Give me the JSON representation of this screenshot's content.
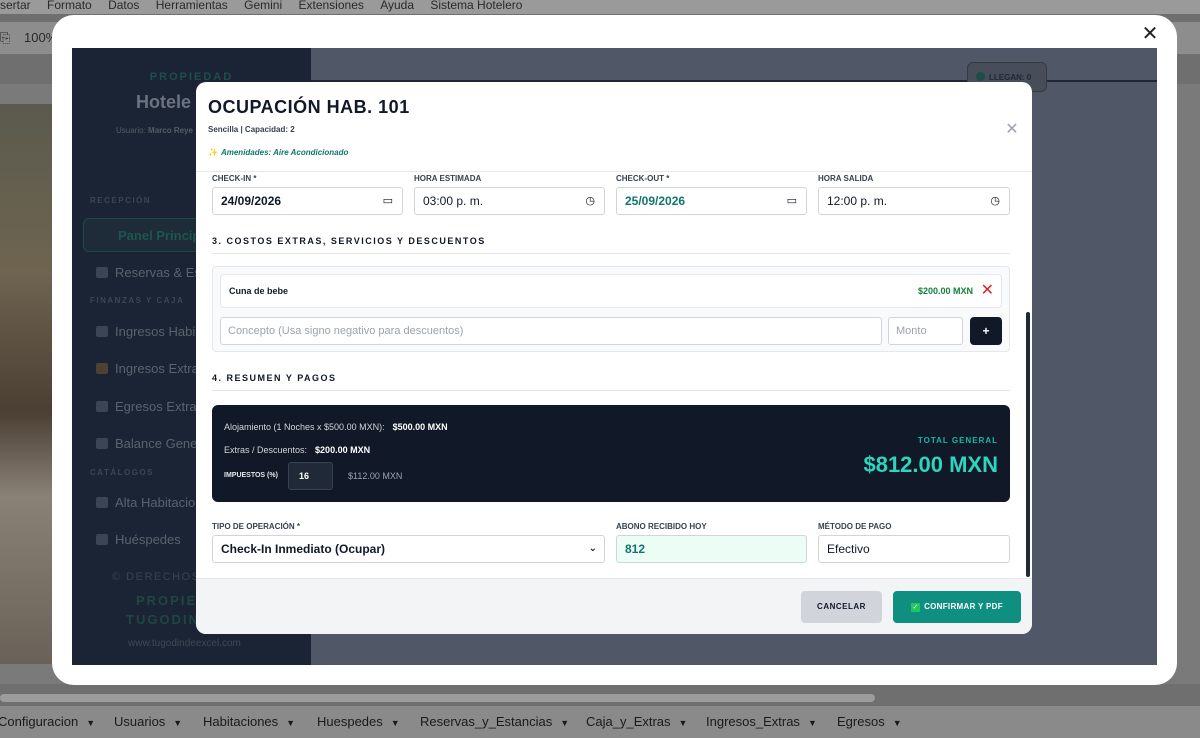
{
  "spreadsheet": {
    "menu": [
      "sertar",
      "Formato",
      "Datos",
      "Herramientas",
      "Gemini",
      "Extensiones",
      "Ayuda",
      "Sistema Hotelero"
    ],
    "zoom": "100%",
    "sheet_tabs": [
      "Configuracion",
      "Usuarios",
      "Habitaciones",
      "Huespedes",
      "Reservas_y_Estancias",
      "Caja_y_Extras",
      "Ingresos_Extras",
      "Egresos"
    ]
  },
  "sidebar": {
    "property_label": "PROPIEDAD",
    "brand": "Hotele",
    "user_label": "Usuario:",
    "user_name": "Marco Reye",
    "sections": {
      "reception": "RECEPCIÓN",
      "finance": "FINANZAS Y CAJA",
      "catalogs": "CATÁLOGOS"
    },
    "items": {
      "panel": "Panel Principa",
      "reservas": "Reservas & Es",
      "ingresos_hab": "Ingresos Habi",
      "ingresos_extra": "Ingresos Extra",
      "egresos": "Egresos Extras",
      "balance": "Balance Gene",
      "alta": "Alta Habitacio",
      "huespedes": "Huéspedes"
    },
    "footer": {
      "copyright": "© DERECHOS",
      "prop": "PROPIE",
      "tugo": "TUGODIN",
      "url": "www.tugodindeexcel.com"
    }
  },
  "header_widget": {
    "llegan_label": "LLEGAN:",
    "llegan_count": "0"
  },
  "modal": {
    "title": "OCUPACIÓN HAB. 101",
    "subtitle": "Sencilla | Capacidad: 2",
    "amenities": "Amenidades: Aire Acondicionado",
    "dates": {
      "checkin_label": "CHECK-IN *",
      "checkin_value": "24/09/2026",
      "hora_estimada_label": "HORA ESTIMADA",
      "hora_estimada_value": "03:00 p. m.",
      "checkout_label": "CHECK-OUT *",
      "checkout_value": "25/09/2026",
      "hora_salida_label": "HORA SALIDA",
      "hora_salida_value": "12:00 p. m."
    },
    "section3_title": "3. COSTOS EXTRAS, SERVICIOS Y DESCUENTOS",
    "extras": [
      {
        "name": "Cuna de bebe",
        "amount": "$200.00 MXN"
      }
    ],
    "concept_placeholder": "Concepto (Usa signo negativo para descuentos)",
    "amount_placeholder": "Monto",
    "add_label": "+",
    "section4_title": "4. RESUMEN Y PAGOS",
    "summary": {
      "alojamiento_label": "Alojamiento (1 Noches x $500.00 MXN):",
      "alojamiento_value": "$500.00 MXN",
      "extras_label": "Extras / Descuentos:",
      "extras_value": "$200.00 MXN",
      "impuestos_label": "IMPUESTOS (%)",
      "impuestos_value": "16",
      "impuestos_amount": "$112.00 MXN",
      "total_label": "TOTAL GENERAL",
      "total_value": "$812.00 MXN"
    },
    "operation": {
      "tipo_label": "TIPO DE OPERACIÓN *",
      "tipo_value": "Check-In Inmediato (Ocupar)",
      "abono_label": "ABONO RECIBIDO HOY",
      "abono_value": "812",
      "metodo_label": "MÉTODO DE PAGO",
      "metodo_value": "Efectivo"
    },
    "cancel_label": "CANCELAR",
    "confirm_label": "CONFIRMAR Y PDF"
  }
}
